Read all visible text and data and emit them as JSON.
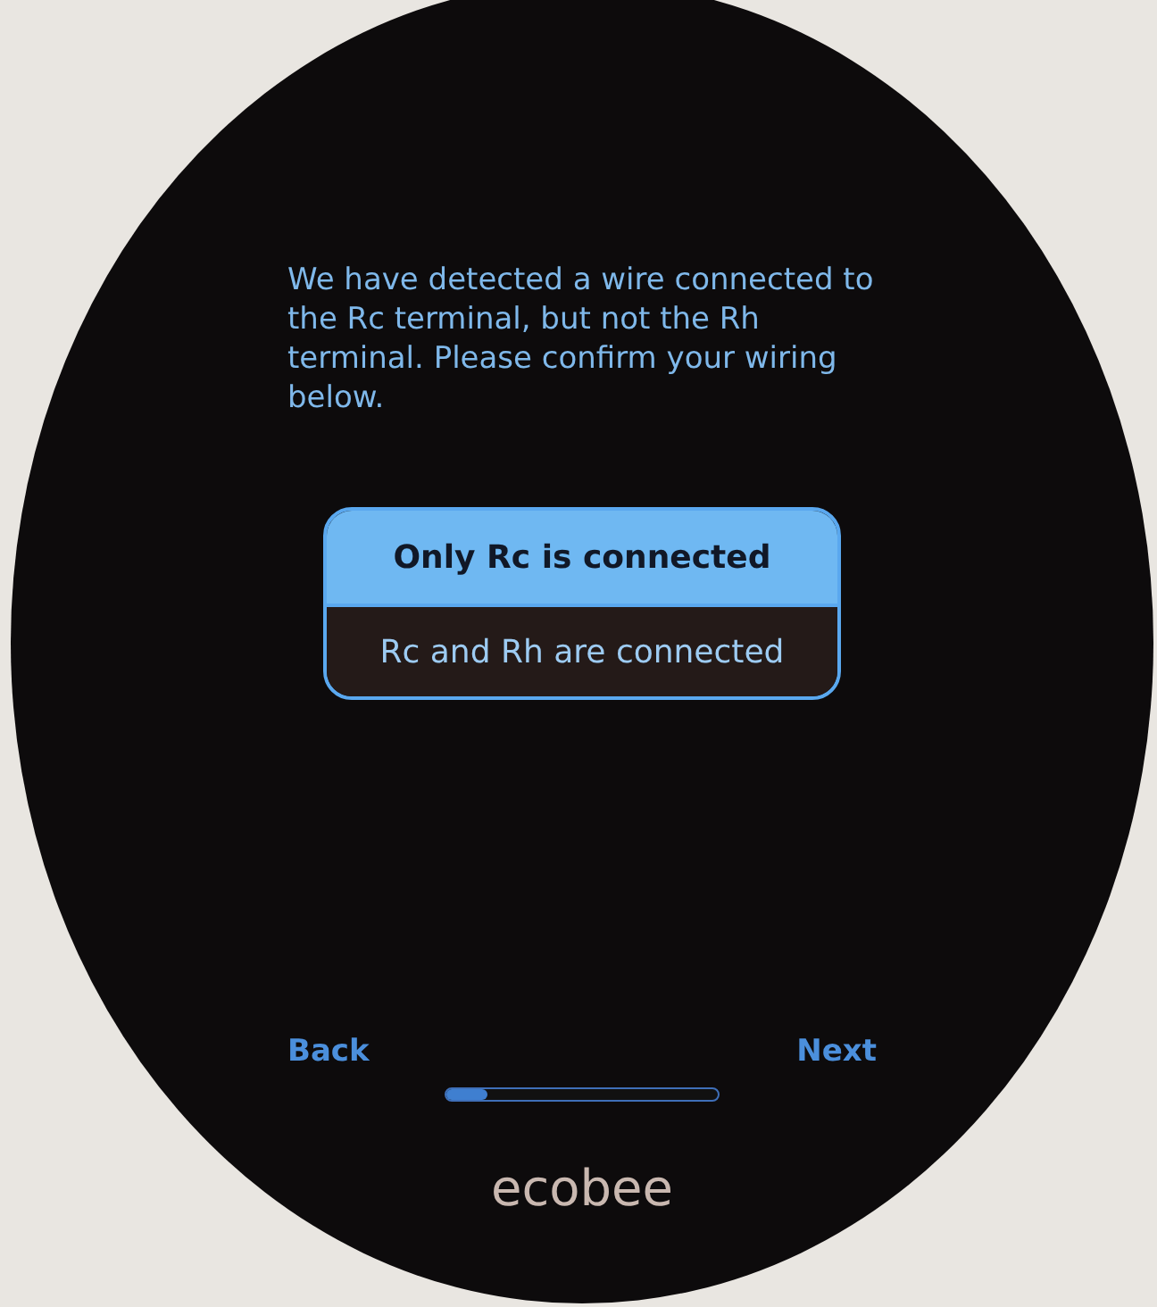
{
  "message": "We have detected a wire connected to the Rc terminal, but not the Rh terminal.  Please confirm your wiring below.",
  "options": [
    {
      "label": "Only Rc is connected",
      "selected": true
    },
    {
      "label": "Rc and Rh are connected",
      "selected": false
    }
  ],
  "navigation": {
    "back": "Back",
    "next": "Next"
  },
  "progress": {
    "level": 0.15
  },
  "brand": "ecobee"
}
